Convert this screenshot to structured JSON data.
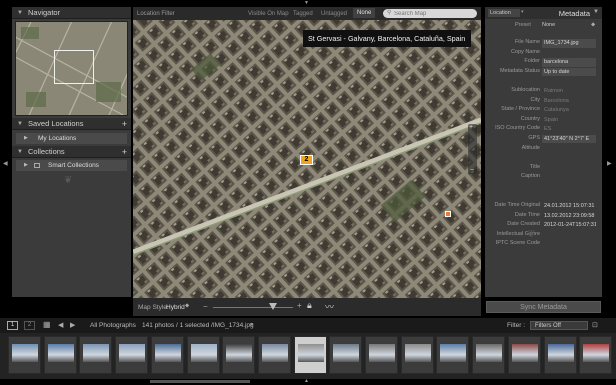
{
  "left_panel": {
    "navigator_title": "Navigator",
    "saved_locations_title": "Saved Locations",
    "my_locations_label": "My Locations",
    "collections_title": "Collections",
    "smart_collections_label": "Smart Collections"
  },
  "map_toolbar": {
    "title": "Location Filter",
    "filters": [
      "Visible On Map",
      "Tagged",
      "Untagged",
      "None"
    ],
    "active_filter": "None",
    "search_placeholder": "Search Map"
  },
  "map": {
    "tooltip": "St Gervasi - Galvany, Barcelona, Cataluña, Spain",
    "pin_label": "2",
    "map_style_label": "Map Style:",
    "map_style_value": "Hybrid"
  },
  "right_panel": {
    "location_dropdown": "Location",
    "metadata_title": "Metadata",
    "preset_label": "Preset",
    "preset_value": "None",
    "fields": [
      {
        "label": "File Name",
        "value": "IMG_1734.jpg",
        "box": true
      },
      {
        "label": "Copy Name",
        "value": "",
        "box": false
      },
      {
        "label": "Folder",
        "value": "barcelona",
        "box": true
      },
      {
        "label": "Metadata Status",
        "value": "Up to date",
        "box": true
      },
      {
        "label": "",
        "value": "",
        "box": false
      },
      {
        "label": "Sublocation",
        "value": "Raimon",
        "box": false,
        "dim": true
      },
      {
        "label": "City",
        "value": "Barcelona",
        "box": false,
        "dim": true
      },
      {
        "label": "State / Province",
        "value": "Catalunya",
        "box": false,
        "dim": true
      },
      {
        "label": "Country",
        "value": "Spain",
        "box": false,
        "dim": true
      },
      {
        "label": "ISO Country Code",
        "value": "ES",
        "box": false,
        "dim": true
      },
      {
        "label": "GPS",
        "value": "41°23'40\" N 2°7' E",
        "box": true
      },
      {
        "label": "Altitude",
        "value": "",
        "box": false
      },
      {
        "label": "",
        "value": "",
        "box": false
      },
      {
        "label": "Title",
        "value": "",
        "box": false
      },
      {
        "label": "Caption",
        "value": "",
        "box": false
      },
      {
        "label": "",
        "value": "",
        "box": false
      },
      {
        "label": "",
        "value": "",
        "box": false
      },
      {
        "label": "Date Time Original",
        "value": "24.01.2012 15:07:31",
        "box": false
      },
      {
        "label": "Date Time",
        "value": "13.02.2012 23:09:58",
        "box": false
      },
      {
        "label": "Date Created",
        "value": "2012-01-24T15:07:31",
        "box": false
      },
      {
        "label": "Intellectual Genre",
        "value": "",
        "box": false
      },
      {
        "label": "IPTC Scene Code",
        "value": "",
        "box": false
      }
    ],
    "sync_button": "Sync Metadata"
  },
  "filmstrip_bar": {
    "page1": "1",
    "page2": "2",
    "source": "All Photographs",
    "info": "141 photos / 1 selected /IMG_1734.jpg",
    "filter_label": "Filter :",
    "filter_value": "Filters Off"
  },
  "filmstrip": {
    "count": 17,
    "selected_index": 8
  },
  "colors": {
    "panel": "#3b3b3b",
    "selected_thumb": "#cfcfcf",
    "pin": "#f0a520"
  }
}
